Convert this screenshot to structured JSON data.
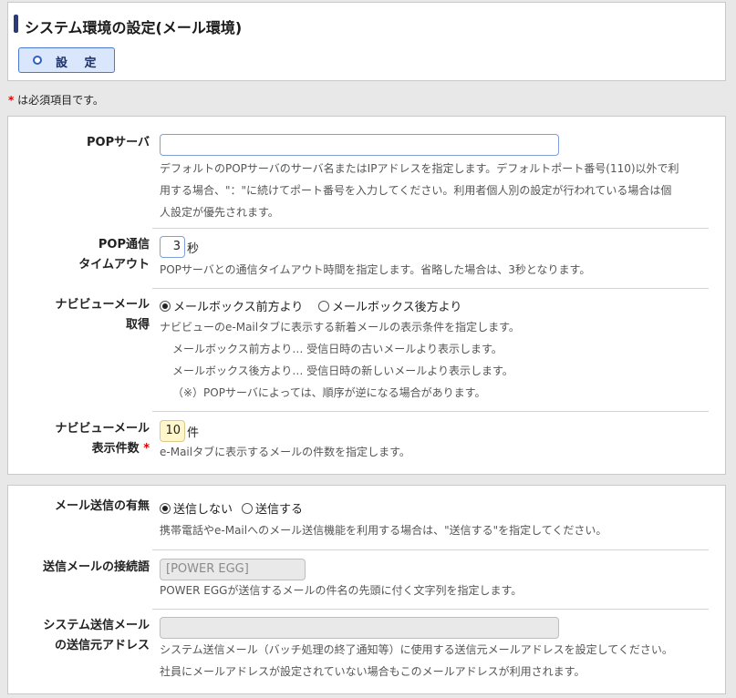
{
  "header": {
    "title": "システム環境の設定(メール環境)",
    "set_button": "設 定",
    "required_note_mark": "*",
    "required_note": "は必須項目です。"
  },
  "pop_server": {
    "label": "POPサーバ",
    "value": "",
    "desc": [
      "デフォルトのPOPサーバのサーバ名またはIPアドレスを指定します。デフォルトポート番号(110)以外で利",
      "用する場合、\"：\"に続けてポート番号を入力してください。利用者個人別の設定が行われている場合は個",
      "人設定が優先されます。"
    ]
  },
  "pop_timeout": {
    "label_line1": "POP通信",
    "label_line2": "タイムアウト",
    "value": "3",
    "unit": "秒",
    "desc": [
      "POPサーバとの通信タイムアウト時間を指定します。省略した場合は、3秒となります。"
    ]
  },
  "navi_fetch": {
    "label_line1": "ナビビューメール",
    "label_line2": "取得",
    "options": [
      "メールボックス前方より",
      "メールボックス後方より"
    ],
    "selected": 0,
    "desc": [
      "ナビビューのe-Mailタブに表示する新着メールの表示条件を指定します。",
      "　メールボックス前方より… 受信日時の古いメールより表示します。",
      "　メールボックス後方より… 受信日時の新しいメールより表示します。",
      "　（※）POPサーバによっては、順序が逆になる場合があります。"
    ]
  },
  "navi_count": {
    "label_line1": "ナビビューメール",
    "label_line2": "表示件数",
    "required_mark": "*",
    "value": "10",
    "unit": "件",
    "desc": [
      "e-Mailタブに表示するメールの件数を指定します。"
    ]
  },
  "mail_send": {
    "label": "メール送信の有無",
    "options": [
      "送信しない",
      "送信する"
    ],
    "selected": 0,
    "desc": [
      "携帯電話やe-Mailへのメール送信機能を利用する場合は、\"送信する\"を指定してください。"
    ]
  },
  "subject_prefix": {
    "label": "送信メールの接続語",
    "value": "[POWER EGG]",
    "desc": [
      "POWER EGGが送信するメールの件名の先頭に付く文字列を指定します。"
    ]
  },
  "system_sender": {
    "label_line1": "システム送信メール",
    "label_line2": "の送信元アドレス",
    "value": "",
    "desc": [
      "システム送信メール（バッチ処理の終了通知等）に使用する送信元メールアドレスを設定してください。",
      "社員にメールアドレスが設定されていない場合もこのメールアドレスが利用されます。"
    ]
  }
}
